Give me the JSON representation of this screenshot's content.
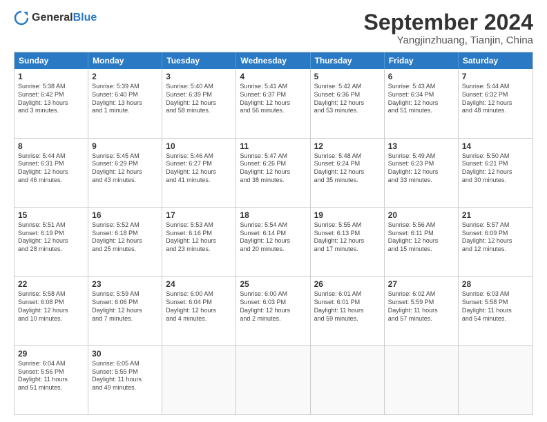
{
  "header": {
    "logo": {
      "general": "General",
      "blue": "Blue"
    },
    "title": "September 2024",
    "location": "Yangjinzhuang, Tianjin, China"
  },
  "days_of_week": [
    "Sunday",
    "Monday",
    "Tuesday",
    "Wednesday",
    "Thursday",
    "Friday",
    "Saturday"
  ],
  "weeks": [
    {
      "cells": [
        {
          "day": "",
          "empty": true
        },
        {
          "day": "",
          "empty": true
        },
        {
          "day": "",
          "empty": true
        },
        {
          "day": "",
          "empty": true
        },
        {
          "day": "",
          "empty": true
        },
        {
          "day": "",
          "empty": true
        },
        {
          "day": "",
          "empty": true
        }
      ]
    }
  ],
  "calendar_data": [
    [
      {
        "num": "1",
        "text": "Sunrise: 5:38 AM\nSunset: 6:42 PM\nDaylight: 13 hours\nand 3 minutes."
      },
      {
        "num": "2",
        "text": "Sunrise: 5:39 AM\nSunset: 6:40 PM\nDaylight: 13 hours\nand 1 minute."
      },
      {
        "num": "3",
        "text": "Sunrise: 5:40 AM\nSunset: 6:39 PM\nDaylight: 12 hours\nand 58 minutes."
      },
      {
        "num": "4",
        "text": "Sunrise: 5:41 AM\nSunset: 6:37 PM\nDaylight: 12 hours\nand 56 minutes."
      },
      {
        "num": "5",
        "text": "Sunrise: 5:42 AM\nSunset: 6:36 PM\nDaylight: 12 hours\nand 53 minutes."
      },
      {
        "num": "6",
        "text": "Sunrise: 5:43 AM\nSunset: 6:34 PM\nDaylight: 12 hours\nand 51 minutes."
      },
      {
        "num": "7",
        "text": "Sunrise: 5:44 AM\nSunset: 6:32 PM\nDaylight: 12 hours\nand 48 minutes."
      }
    ],
    [
      {
        "num": "8",
        "text": "Sunrise: 5:44 AM\nSunset: 6:31 PM\nDaylight: 12 hours\nand 46 minutes."
      },
      {
        "num": "9",
        "text": "Sunrise: 5:45 AM\nSunset: 6:29 PM\nDaylight: 12 hours\nand 43 minutes."
      },
      {
        "num": "10",
        "text": "Sunrise: 5:46 AM\nSunset: 6:27 PM\nDaylight: 12 hours\nand 41 minutes."
      },
      {
        "num": "11",
        "text": "Sunrise: 5:47 AM\nSunset: 6:26 PM\nDaylight: 12 hours\nand 38 minutes."
      },
      {
        "num": "12",
        "text": "Sunrise: 5:48 AM\nSunset: 6:24 PM\nDaylight: 12 hours\nand 35 minutes."
      },
      {
        "num": "13",
        "text": "Sunrise: 5:49 AM\nSunset: 6:23 PM\nDaylight: 12 hours\nand 33 minutes."
      },
      {
        "num": "14",
        "text": "Sunrise: 5:50 AM\nSunset: 6:21 PM\nDaylight: 12 hours\nand 30 minutes."
      }
    ],
    [
      {
        "num": "15",
        "text": "Sunrise: 5:51 AM\nSunset: 6:19 PM\nDaylight: 12 hours\nand 28 minutes."
      },
      {
        "num": "16",
        "text": "Sunrise: 5:52 AM\nSunset: 6:18 PM\nDaylight: 12 hours\nand 25 minutes."
      },
      {
        "num": "17",
        "text": "Sunrise: 5:53 AM\nSunset: 6:16 PM\nDaylight: 12 hours\nand 23 minutes."
      },
      {
        "num": "18",
        "text": "Sunrise: 5:54 AM\nSunset: 6:14 PM\nDaylight: 12 hours\nand 20 minutes."
      },
      {
        "num": "19",
        "text": "Sunrise: 5:55 AM\nSunset: 6:13 PM\nDaylight: 12 hours\nand 17 minutes."
      },
      {
        "num": "20",
        "text": "Sunrise: 5:56 AM\nSunset: 6:11 PM\nDaylight: 12 hours\nand 15 minutes."
      },
      {
        "num": "21",
        "text": "Sunrise: 5:57 AM\nSunset: 6:09 PM\nDaylight: 12 hours\nand 12 minutes."
      }
    ],
    [
      {
        "num": "22",
        "text": "Sunrise: 5:58 AM\nSunset: 6:08 PM\nDaylight: 12 hours\nand 10 minutes."
      },
      {
        "num": "23",
        "text": "Sunrise: 5:59 AM\nSunset: 6:06 PM\nDaylight: 12 hours\nand 7 minutes."
      },
      {
        "num": "24",
        "text": "Sunrise: 6:00 AM\nSunset: 6:04 PM\nDaylight: 12 hours\nand 4 minutes."
      },
      {
        "num": "25",
        "text": "Sunrise: 6:00 AM\nSunset: 6:03 PM\nDaylight: 12 hours\nand 2 minutes."
      },
      {
        "num": "26",
        "text": "Sunrise: 6:01 AM\nSunset: 6:01 PM\nDaylight: 11 hours\nand 59 minutes."
      },
      {
        "num": "27",
        "text": "Sunrise: 6:02 AM\nSunset: 5:59 PM\nDaylight: 11 hours\nand 57 minutes."
      },
      {
        "num": "28",
        "text": "Sunrise: 6:03 AM\nSunset: 5:58 PM\nDaylight: 11 hours\nand 54 minutes."
      }
    ],
    [
      {
        "num": "29",
        "text": "Sunrise: 6:04 AM\nSunset: 5:56 PM\nDaylight: 11 hours\nand 51 minutes."
      },
      {
        "num": "30",
        "text": "Sunrise: 6:05 AM\nSunset: 5:55 PM\nDaylight: 11 hours\nand 49 minutes."
      },
      {
        "num": "",
        "empty": true
      },
      {
        "num": "",
        "empty": true
      },
      {
        "num": "",
        "empty": true
      },
      {
        "num": "",
        "empty": true
      },
      {
        "num": "",
        "empty": true
      }
    ]
  ]
}
